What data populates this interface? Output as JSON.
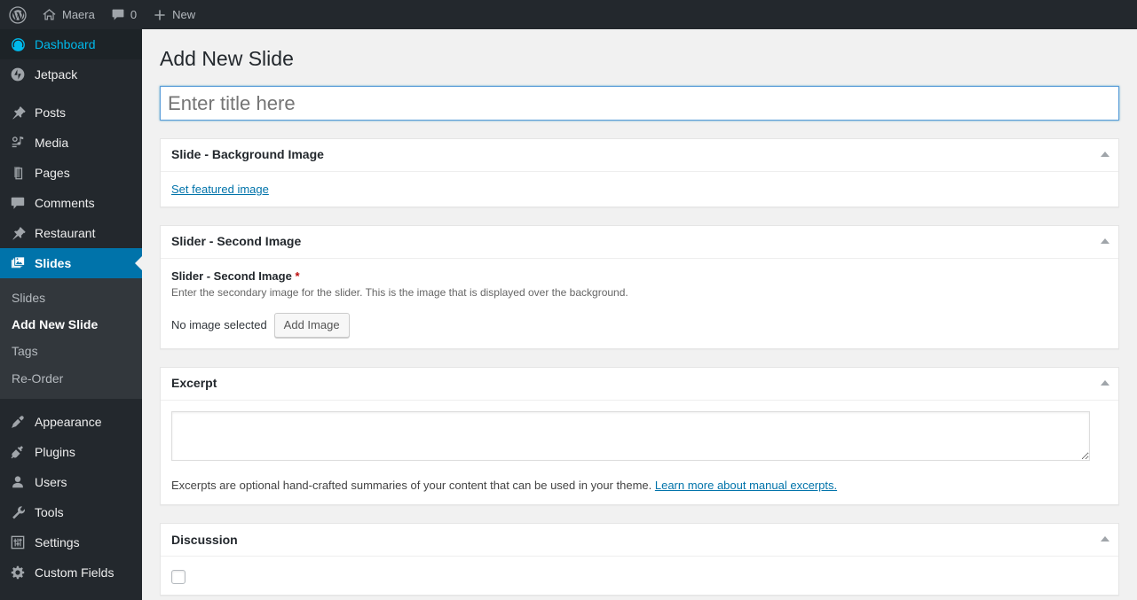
{
  "adminbar": {
    "items": [
      {
        "icon": "wordpress-logo-icon",
        "label": ""
      },
      {
        "icon": "home-icon",
        "label": "Maera"
      },
      {
        "icon": "comment-bubble-icon",
        "label": "0"
      },
      {
        "icon": "plus-icon",
        "label": "New"
      }
    ]
  },
  "sidebar": {
    "items": [
      {
        "label": "Dashboard",
        "icon": "dashboard-icon",
        "state": "current"
      },
      {
        "label": "Jetpack",
        "icon": "jetpack-icon",
        "state": ""
      },
      {
        "label": "Posts",
        "icon": "pin-icon",
        "state": ""
      },
      {
        "label": "Media",
        "icon": "media-icon",
        "state": ""
      },
      {
        "label": "Pages",
        "icon": "pages-icon",
        "state": ""
      },
      {
        "label": "Comments",
        "icon": "comment-bubble-icon",
        "state": ""
      },
      {
        "label": "Restaurant",
        "icon": "pin-icon",
        "state": ""
      },
      {
        "label": "Slides",
        "icon": "slides-icon",
        "state": "active"
      }
    ],
    "submenu": [
      {
        "label": "Slides",
        "current": false
      },
      {
        "label": "Add New Slide",
        "current": true
      },
      {
        "label": "Tags",
        "current": false
      },
      {
        "label": "Re-Order",
        "current": false
      }
    ],
    "items_lower": [
      {
        "label": "Appearance",
        "icon": "paintbrush-icon"
      },
      {
        "label": "Plugins",
        "icon": "plug-icon"
      },
      {
        "label": "Users",
        "icon": "user-icon"
      },
      {
        "label": "Tools",
        "icon": "wrench-icon"
      },
      {
        "label": "Settings",
        "icon": "sliders-icon"
      },
      {
        "label": "Custom Fields",
        "icon": "gear-icon"
      }
    ],
    "colors": {
      "background": "#23282d",
      "submenu_background": "#32373c",
      "active": "#0073aa",
      "current_text": "#00b9eb"
    }
  },
  "main": {
    "page_title": "Add New Slide",
    "title_input": {
      "value": "",
      "placeholder": "Enter title here"
    },
    "boxes": [
      {
        "title": "Slide - Background Image",
        "featured_image_link": "Set featured image"
      },
      {
        "title": "Slider - Second Image",
        "field_label": "Slider - Second Image",
        "required_marker": "*",
        "field_desc": "Enter the secondary image for the slider. This is the image that is displayed over the background.",
        "file_status": "No image selected",
        "add_button": "Add Image"
      },
      {
        "title": "Excerpt",
        "textarea_value": "",
        "note_text": "Excerpts are optional hand-crafted summaries of your content that can be used in your theme. ",
        "note_link": "Learn more about manual excerpts."
      },
      {
        "title": "Discussion"
      }
    ]
  },
  "theme": {
    "accent": "#0073aa",
    "link": "#0073aa",
    "required_red": "#bc0b0b",
    "content_bg": "#f1f1f1",
    "focus_border": "#5b9dd9"
  }
}
